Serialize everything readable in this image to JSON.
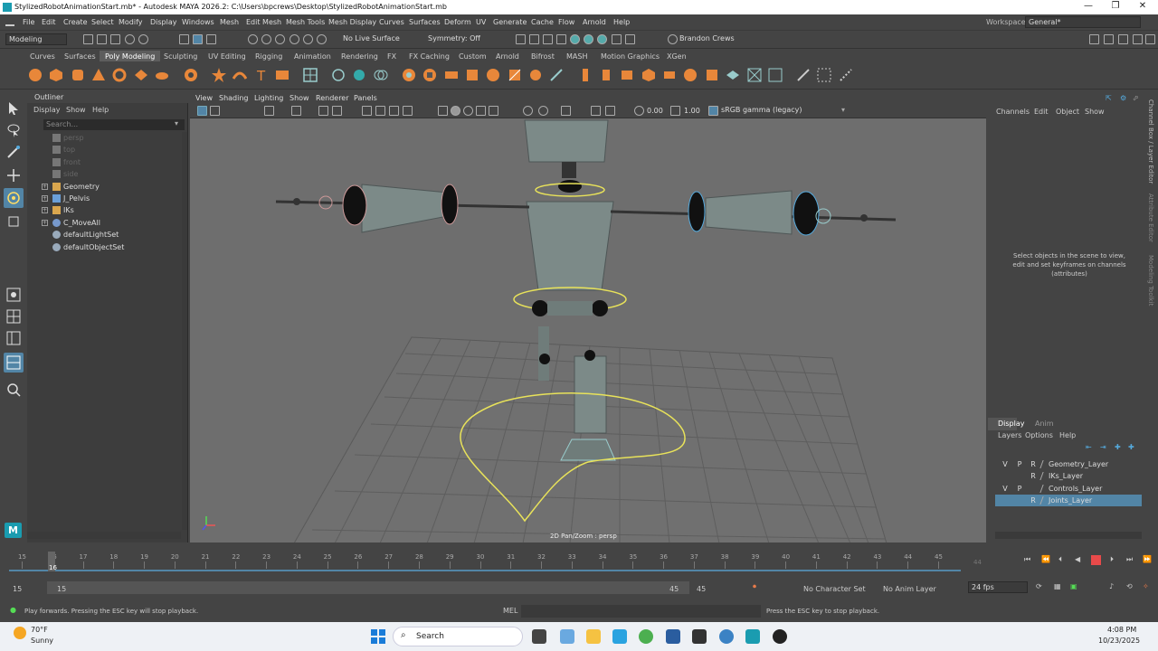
{
  "window": {
    "title": "StylizedRobotAnimationStart.mb* - Autodesk MAYA 2026.2: C:\\Users\\bpcrews\\Desktop\\StylizedRobotAnimationStart.mb",
    "controls": [
      "—",
      "❐",
      "✕"
    ]
  },
  "menubar": {
    "items": [
      "File",
      "Edit",
      "Create",
      "Select",
      "Modify",
      "Display",
      "Windows",
      "Mesh",
      "Edit Mesh",
      "Mesh Tools",
      "Mesh Display",
      "Curves",
      "Surfaces",
      "Deform",
      "UV",
      "Generate",
      "Cache",
      "Flow",
      "Arnold",
      "Help"
    ],
    "workspace_label": "Workspace:",
    "workspace_value": "General*"
  },
  "statusline": {
    "mode": "Modeling",
    "live_surface": "No Live Surface",
    "symmetry": "Symmetry: Off",
    "user": "Brandon Crews"
  },
  "shelf": {
    "tabs": [
      "Curves",
      "Surfaces",
      "Poly Modeling",
      "Sculpting",
      "UV Editing",
      "Rigging",
      "Animation",
      "Rendering",
      "FX",
      "FX Caching",
      "Custom",
      "Arnold",
      "Bifrost",
      "MASH",
      "Motion Graphics",
      "XGen"
    ],
    "active_tab": "Poly Modeling"
  },
  "outliner": {
    "title": "Outliner",
    "menu": [
      "Display",
      "Show",
      "Help"
    ],
    "search_placeholder": "Search...",
    "items": [
      {
        "label": "persp",
        "type": "camera",
        "dim": true,
        "expandable": false
      },
      {
        "label": "top",
        "type": "camera",
        "dim": true,
        "expandable": false
      },
      {
        "label": "front",
        "type": "camera",
        "dim": true,
        "expandable": false
      },
      {
        "label": "side",
        "type": "camera",
        "dim": true,
        "expandable": false
      },
      {
        "label": "Geometry",
        "type": "group",
        "dim": false,
        "expandable": true
      },
      {
        "label": "J_Pelvis",
        "type": "joint",
        "dim": false,
        "expandable": true
      },
      {
        "label": "IKs",
        "type": "group",
        "dim": false,
        "expandable": true
      },
      {
        "label": "C_MoveAll",
        "type": "curve",
        "dim": false,
        "expandable": true
      },
      {
        "label": "defaultLightSet",
        "type": "set",
        "dim": false,
        "expandable": false
      },
      {
        "label": "defaultObjectSet",
        "type": "set",
        "dim": false,
        "expandable": false
      }
    ]
  },
  "viewport": {
    "menu": [
      "View",
      "Shading",
      "Lighting",
      "Show",
      "Renderer",
      "Panels"
    ],
    "exposure": "0.00",
    "gamma": "1.00",
    "color_space": "sRGB gamma (legacy)",
    "hud_label": "2D Pan/Zoom : persp"
  },
  "channelbox": {
    "menu": [
      "Channels",
      "Edit",
      "Object",
      "Show"
    ],
    "message": "Select objects in the scene to view, edit and set keyframes on channels (attributes)"
  },
  "side_tabs": [
    "Channel Box / Layer Editor",
    "Attribute Editor",
    "Modeling Toolkit"
  ],
  "layer_editor": {
    "tabs": [
      "Display",
      "Anim"
    ],
    "menu": [
      "Layers",
      "Options",
      "Help"
    ],
    "layers": [
      {
        "v": "V",
        "p": "P",
        "r": "R",
        "name": "Geometry_Layer",
        "selected": false
      },
      {
        "v": "",
        "p": "",
        "r": "R",
        "name": "IKs_Layer",
        "selected": false
      },
      {
        "v": "V",
        "p": "P",
        "r": "",
        "name": "Controls_Layer",
        "selected": false
      },
      {
        "v": "",
        "p": "",
        "r": "R",
        "name": "Joints_Layer",
        "selected": true
      }
    ]
  },
  "timeline": {
    "ticks": [
      "15",
      "16",
      "17",
      "18",
      "19",
      "20",
      "21",
      "22",
      "23",
      "24",
      "25",
      "26",
      "27",
      "28",
      "29",
      "30",
      "31",
      "32",
      "33",
      "34",
      "35",
      "36",
      "37",
      "38",
      "39",
      "40",
      "41",
      "42",
      "43",
      "44",
      "45"
    ],
    "current_frame": "16",
    "end_marker": "44"
  },
  "range": {
    "start": "15",
    "playback_start": "15",
    "playback_end": "45",
    "end": "45",
    "character_set": "No Character Set",
    "anim_layer": "No Anim Layer",
    "fps": "24 fps"
  },
  "commandline": {
    "help_left": "Play forwards. Pressing the ESC key will stop playback.",
    "lang": "MEL",
    "help_right": "Press the ESC key to stop playback."
  },
  "taskbar": {
    "weather_temp": "70°F",
    "weather_cond": "Sunny",
    "search": "Search",
    "time": "4:08 PM",
    "date": "10/23/2025"
  },
  "colors": {
    "accent_blue": "#5285a6",
    "selection_yellow": "#e8e25a",
    "viewport_bg": "#6e6e6e",
    "panel_bg": "#444444",
    "playhead_red": "#e84a4a"
  }
}
